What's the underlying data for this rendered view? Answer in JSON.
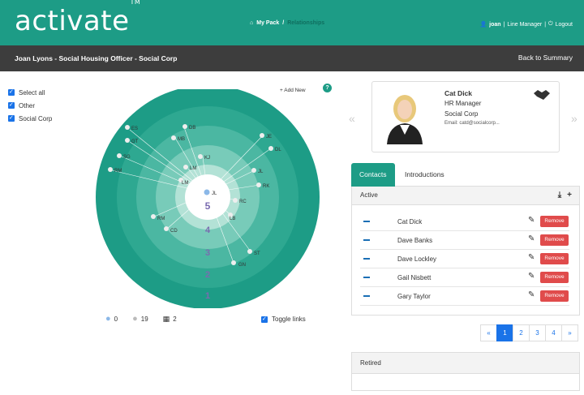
{
  "header": {
    "logo": "activate",
    "logo_tm": "TM",
    "breadcrumb": [
      "My Pack",
      "Relationships"
    ],
    "user": "joan",
    "role": "Line Manager",
    "logout": "Logout"
  },
  "subbar": {
    "title": "Joan Lyons - Social Housing Officer - Social Corp",
    "back": "Back to Summary"
  },
  "filters": [
    "Select all",
    "Other",
    "Social Corp"
  ],
  "graph": {
    "add_new": "+ Add New",
    "help": "?",
    "ring_labels": [
      "5",
      "4",
      "3",
      "2",
      "1"
    ],
    "center_label": "JL",
    "nodes": [
      "ES",
      "GT",
      "SG",
      "RM",
      "DB",
      "MB",
      "KJ",
      "LM",
      "LM",
      "JE",
      "DL",
      "JL",
      "RK",
      "RC",
      "LB",
      "RM",
      "CD",
      "ST",
      "GN"
    ]
  },
  "stats": {
    "a": "0",
    "b": "19",
    "c": "2"
  },
  "toggle_links": "Toggle links",
  "card": {
    "name": "Cat Dick",
    "role": "HR Manager",
    "org": "Social Corp",
    "email": "Email: catd@socialcorp..."
  },
  "tabs": {
    "contacts": "Contacts",
    "introductions": "Introductions"
  },
  "active_panel": {
    "title": "Active",
    "remove_label": "Remove",
    "contacts": [
      "Cat Dick",
      "Dave Banks",
      "Dave Lockley",
      "Gail Nisbett",
      "Gary Taylor"
    ]
  },
  "pagination": [
    "«",
    "1",
    "2",
    "3",
    "4",
    "»"
  ],
  "retired": {
    "title": "Retired"
  },
  "colors": {
    "brand": "#1d9c86",
    "dark_bar": "#3d3d3d",
    "remove": "#e04b4b",
    "link": "#1a73e8"
  }
}
